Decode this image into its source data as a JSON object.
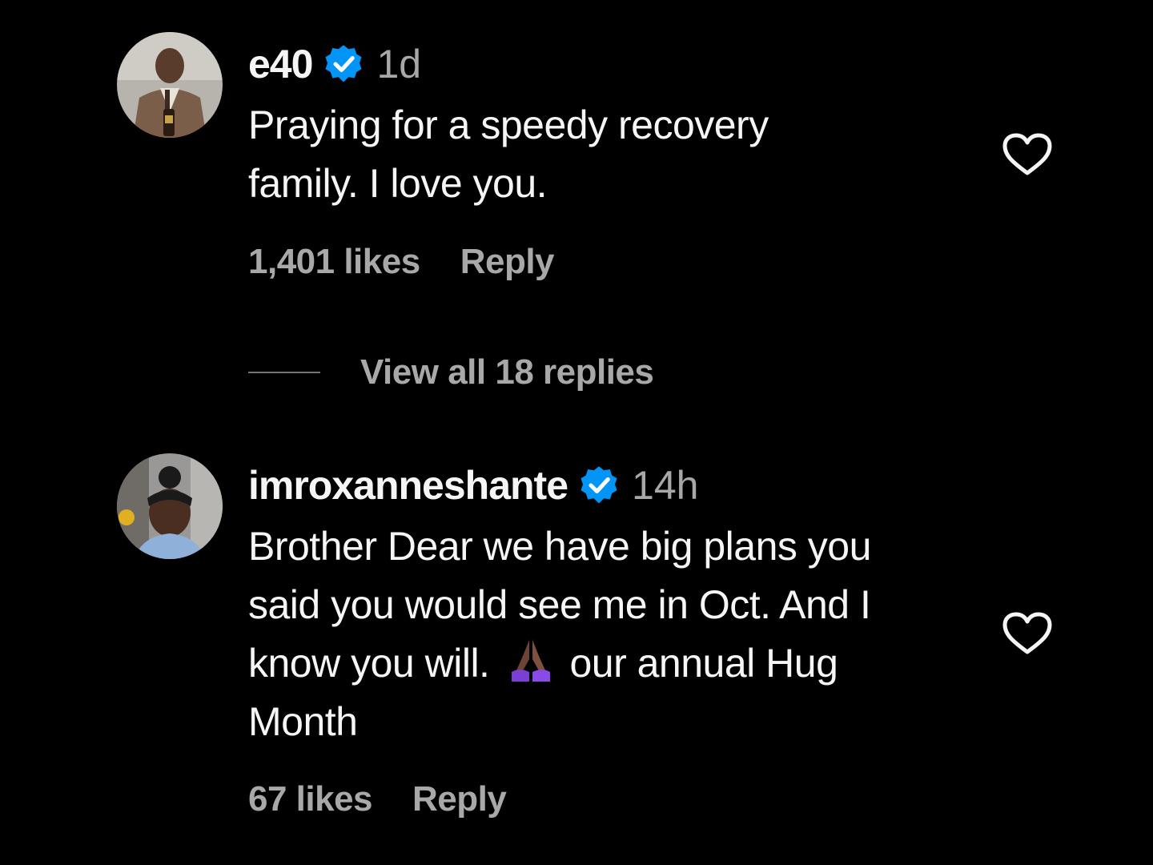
{
  "colors": {
    "background": "#000000",
    "primary_text": "#f5f5f5",
    "secondary_text": "#a8a8a8",
    "verified_badge": "#0095f6"
  },
  "comments": [
    {
      "username": "e40",
      "verified": true,
      "time": "1d",
      "text": "Praying for a speedy recovery\nfamily. I love you.",
      "likes": "1,401 likes",
      "reply_label": "Reply",
      "like_icon": "heart-outline-icon",
      "view_replies_label": "View all 18 replies"
    },
    {
      "username": "imroxanneshante",
      "verified": true,
      "time": "14h",
      "text_before_emoji": "Brother Dear we have big plans you\nsaid you would see me in Oct. And I\nknow you will.",
      "emoji": "🙏🏿",
      "text_after_emoji": "our annual Hug\nMonth",
      "likes": "67 likes",
      "reply_label": "Reply",
      "like_icon": "heart-outline-icon"
    }
  ]
}
